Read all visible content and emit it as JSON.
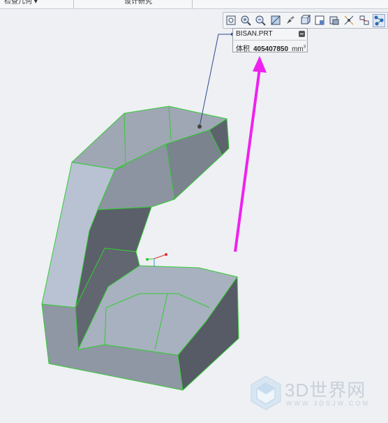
{
  "topbar": {
    "left_label": "检查几何 ▾",
    "mid_label": "设计研究"
  },
  "toolbar": {
    "buttons": [
      {
        "name": "refit-icon"
      },
      {
        "name": "zoom-in-icon"
      },
      {
        "name": "zoom-out-icon"
      },
      {
        "name": "repaint-icon"
      },
      {
        "name": "display-style-icon"
      },
      {
        "name": "view-orient-icon"
      },
      {
        "name": "saved-views-icon"
      },
      {
        "name": "view-manager-icon"
      },
      {
        "name": "datum-display-icon"
      },
      {
        "name": "annotation-display-icon"
      },
      {
        "name": "spin-center-icon"
      }
    ]
  },
  "tooltip": {
    "title": "BISAN.PRT",
    "property_label": "体积",
    "value": "405407850",
    "unit": "mm",
    "unit_power": "3"
  },
  "watermark": {
    "brand": "3D世界网",
    "url": "WWW.3DSJW.COM"
  },
  "colors": {
    "background": "#eef0f4",
    "edge_highlight": "#33cc33",
    "arrow": "#ee22ee",
    "face_light": "#b9c3d3",
    "face_mid": "#8d95a2",
    "face_dark": "#5a5f69"
  }
}
